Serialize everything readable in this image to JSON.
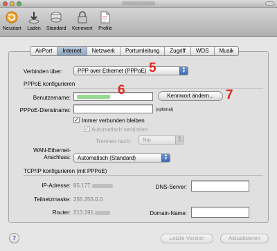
{
  "toolbar": {
    "items": [
      {
        "label": "Neustart",
        "icon": "restart-icon"
      },
      {
        "label": "Laden",
        "icon": "download-icon"
      },
      {
        "label": "Standard",
        "icon": "standard-icon"
      },
      {
        "label": "Kennwort",
        "icon": "lock-icon"
      },
      {
        "label": "Profile",
        "icon": "document-icon"
      }
    ]
  },
  "tabs": [
    {
      "label": "AirPort",
      "active": false
    },
    {
      "label": "Internet",
      "active": true
    },
    {
      "label": "Netzwerk",
      "active": false
    },
    {
      "label": "Portumleitung",
      "active": false
    },
    {
      "label": "Zugriff",
      "active": false
    },
    {
      "label": "WDS",
      "active": false
    },
    {
      "label": "Musik",
      "active": false
    }
  ],
  "connect": {
    "label": "Verbinden über:",
    "value": "PPP over Ethernet (PPPoE)",
    "marker": "5"
  },
  "pppoe": {
    "section_title": "PPPoE konfigurieren",
    "username_label": "Benutzername:",
    "username_value": "",
    "username_marker": "6",
    "password_button": "Kennwort ändern...",
    "password_marker": "7",
    "service_label": "PPPoE-Dienstname:",
    "service_value": "",
    "service_hint": "(optional)",
    "always_connected": "Immer verbunden bleiben",
    "auto_connect": "Automatisch verbinden",
    "disconnect_label": "Trennen nach:",
    "disconnect_value": "Nie",
    "wan_label_1": "WAN-Ethernet-",
    "wan_label_2": "Anschluss:",
    "wan_value": "Automatisch (Standard)"
  },
  "tcpip": {
    "section_title": "TCP/IP konfigurieren (mit PPPoE)",
    "ip_label": "IP-Adresse:",
    "ip_value": "85.177.",
    "subnet_label": "Teilnetzmaske:",
    "subnet_value": "255.255.0.0",
    "router_label": "Router:",
    "router_value": "213.191.",
    "dns_label": "DNS-Server:",
    "domain_label": "Domain-Name:"
  },
  "footer": {
    "help": "?",
    "revert_button": "Letzte Version",
    "update_button": "Aktualisieren"
  },
  "colors": {
    "marker": "#e0261f",
    "active_tab": "#8fa6c3",
    "popup_arrows": "#3d6cb3"
  }
}
